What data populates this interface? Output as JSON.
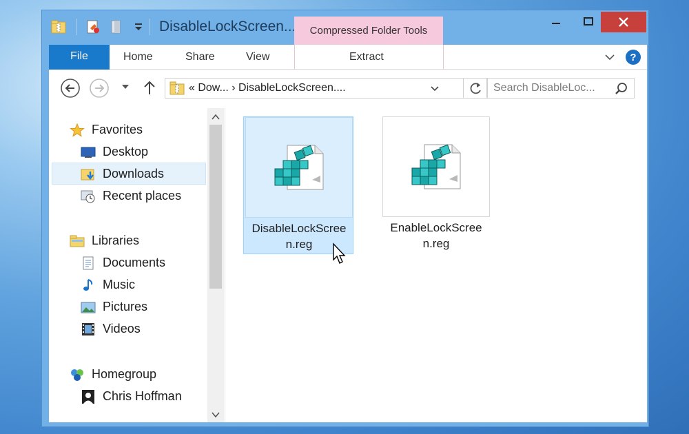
{
  "window": {
    "title": "DisableLockScreen...",
    "contextual_tab_header": "Compressed Folder Tools"
  },
  "ribbon": {
    "tabs": [
      "File",
      "Home",
      "Share",
      "View",
      "Extract"
    ]
  },
  "address_bar": {
    "path": "«  Dow...  ›  DisableLockScreen....",
    "search_placeholder": "Search DisableLoc..."
  },
  "nav_pane": {
    "favorites": {
      "label": "Favorites",
      "items": [
        "Desktop",
        "Downloads",
        "Recent places"
      ],
      "selected": "Downloads"
    },
    "libraries": {
      "label": "Libraries",
      "items": [
        "Documents",
        "Music",
        "Pictures",
        "Videos"
      ]
    },
    "homegroup": {
      "label": "Homegroup",
      "items": [
        "Chris Hoffman"
      ]
    }
  },
  "files": [
    {
      "name_line1": "DisableLockScree",
      "name_line2": "n.reg",
      "icon": "registry-file-icon",
      "selected": true
    },
    {
      "name_line1": "EnableLockScree",
      "name_line2": "n.reg",
      "icon": "registry-file-icon",
      "selected": false
    }
  ],
  "colors": {
    "window_frame": "#71b1e8",
    "file_tab": "#1979ca",
    "context_tab": "#f7c9dc",
    "close_button": "#c7403b",
    "selection": "#cce8ff"
  }
}
